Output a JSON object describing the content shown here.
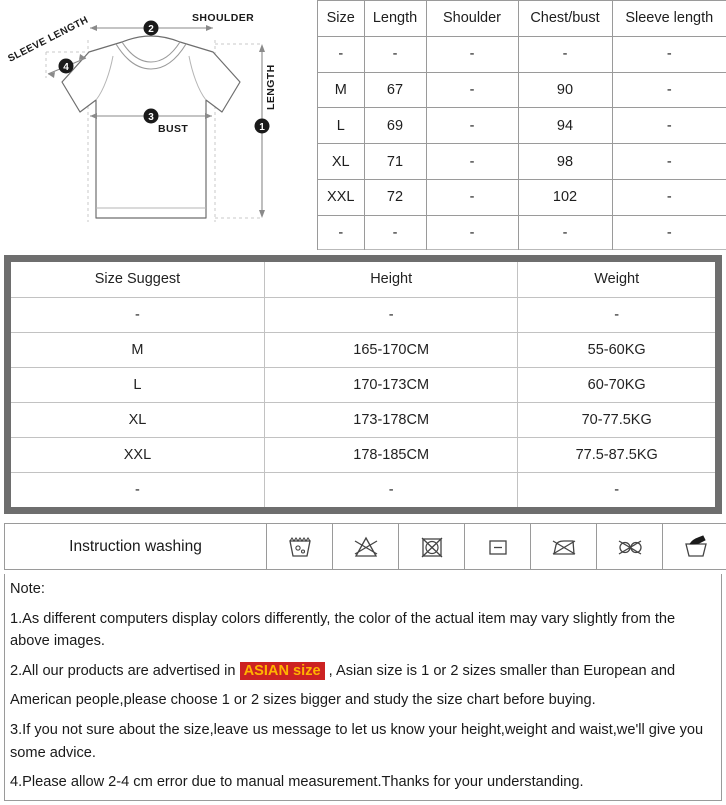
{
  "diagram": {
    "title": "tshirt-measurement-diagram",
    "markers": [
      {
        "number": "1",
        "label": "LENGTH"
      },
      {
        "number": "2",
        "label": "SHOULDER"
      },
      {
        "number": "3",
        "label": "BUST"
      },
      {
        "number": "4",
        "label": "SLEEVE LENGTH"
      }
    ],
    "label_length": "LENGTH",
    "label_shoulder": "SHOULDER",
    "label_bust": "BUST",
    "label_sleeve": "SLEEVE LENGTH",
    "num_1": "1",
    "num_2": "2",
    "num_3": "3",
    "num_4": "4"
  },
  "measure_table": {
    "headers": [
      "Size",
      "Length",
      "Shoulder",
      "Chest/bust",
      "Sleeve length"
    ],
    "rows": [
      [
        "-",
        "-",
        "-",
        "-",
        "-"
      ],
      [
        "M",
        "67",
        "-",
        "90",
        "-"
      ],
      [
        "L",
        "69",
        "-",
        "94",
        "-"
      ],
      [
        "XL",
        "71",
        "-",
        "98",
        "-"
      ],
      [
        "XXL",
        "72",
        "-",
        "102",
        "-"
      ],
      [
        "-",
        "-",
        "-",
        "-",
        "-"
      ]
    ]
  },
  "suggest_table": {
    "headers": [
      "Size Suggest",
      "Height",
      "Weight"
    ],
    "rows": [
      [
        "-",
        "-",
        "-"
      ],
      [
        "M",
        "165-170CM",
        "55-60KG"
      ],
      [
        "L",
        "170-173CM",
        "60-70KG"
      ],
      [
        "XL",
        "173-178CM",
        "70-77.5KG"
      ],
      [
        "XXL",
        "178-185CM",
        "77.5-87.5KG"
      ],
      [
        "-",
        "-",
        "-"
      ]
    ]
  },
  "washing": {
    "label": "Instruction washing",
    "icons": [
      "machine-wash-icon",
      "do-not-bleach-icon",
      "do-not-tumble-dry-icon",
      "flat-dry-icon",
      "do-not-iron-icon",
      "do-not-dry-clean-icon",
      "hand-wash-icon"
    ]
  },
  "notes": {
    "heading": "Note:",
    "item1_part1": "1.As different computers display colors differently, the color of the actual item may vary slightly from the above images.",
    "item2_before": "2.All our products are advertised in ",
    "item2_highlight": "ASIAN size",
    "item2_after": " , Asian size is 1 or 2 sizes smaller than European and",
    "item2_line2": "American people,please choose 1 or 2 sizes bigger and study the size chart before buying.",
    "item3": "3.If you not sure about the size,leave us message to let us know your height,weight and waist,we'll give you some advice.",
    "item4": "4.Please allow 2-4 cm error due to manual measurement.Thanks for your understanding."
  },
  "colors": {
    "highlight_bg": "#cc2222",
    "highlight_text": "#ffb300",
    "frame_gray": "#6e6e6e",
    "line_gray": "#9a9a9a"
  }
}
